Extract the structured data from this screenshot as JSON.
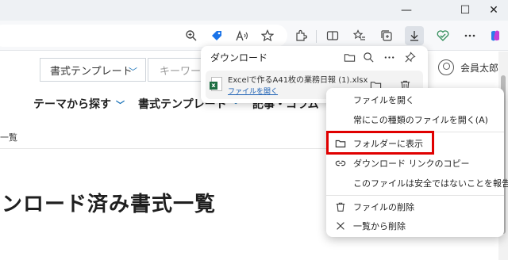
{
  "toolbar": {
    "icons": [
      "zoom-icon",
      "tag-icon",
      "read-aloud-icon",
      "favorite-star-icon",
      "extensions-icon",
      "split-screen-icon",
      "favorites-icon",
      "collections-icon",
      "downloads-icon",
      "browser-essentials-icon",
      "more-icon",
      "copilot-icon"
    ]
  },
  "window": {
    "minimize": "—",
    "maximize": "☐",
    "close": "✕"
  },
  "site": {
    "template_select": "書式テンプレート",
    "keyword_placeholder": "キーワー",
    "user_name": "会員太郎",
    "nav": [
      "テーマから探す",
      "書式テンプレート",
      "記事・コラム"
    ],
    "breadcrumb": "一覧",
    "heading": "ンロード済み書式一覧"
  },
  "downloads": {
    "title": "ダウンロード",
    "file_name": "Excelで作るA41枚の業務日報 (1).xlsx",
    "open_link": "ファイルを開く"
  },
  "context_menu": {
    "items": [
      {
        "label": "ファイルを開く",
        "icon": ""
      },
      {
        "label": "常にこの種類のファイルを開く(A)",
        "icon": ""
      },
      {
        "label": "フォルダーに表示",
        "icon": "folder-icon"
      },
      {
        "label": "ダウンロード リンクのコピー",
        "icon": "link-icon"
      },
      {
        "label": "このファイルは安全ではないことを報告する",
        "icon": ""
      },
      {
        "label": "ファイルの削除",
        "icon": "trash-icon"
      },
      {
        "label": "一覧から削除",
        "icon": "close-icon"
      }
    ],
    "highlight_color": "#e00000"
  }
}
